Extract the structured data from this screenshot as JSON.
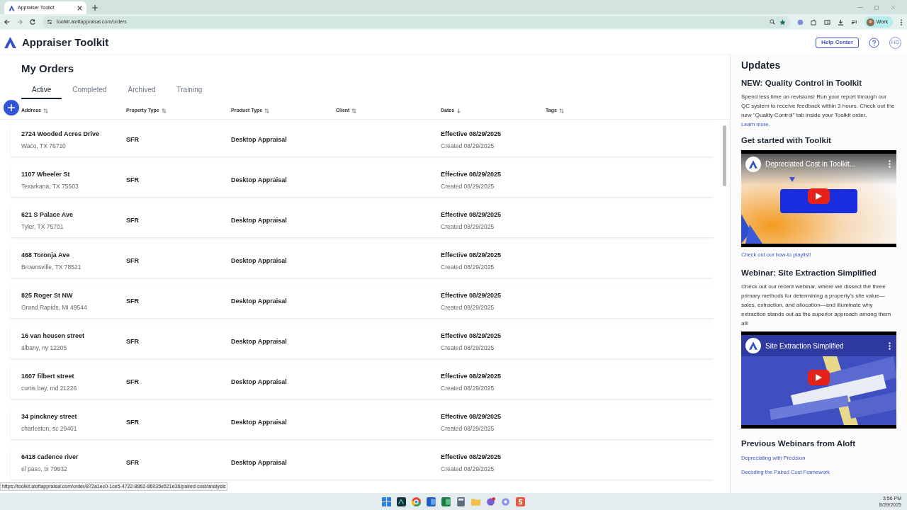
{
  "browser": {
    "tab_title": "Appraiser Toolkit",
    "url": "toolkit.aloftappraisal.com/orders",
    "profile_label": "Work"
  },
  "app": {
    "title": "Appraiser Toolkit",
    "help_button": "Help Center",
    "avatar_initials": "HD"
  },
  "page_title": "My Orders",
  "tabs": [
    {
      "label": "Active",
      "selected": true
    },
    {
      "label": "Completed",
      "selected": false
    },
    {
      "label": "Archived",
      "selected": false
    },
    {
      "label": "Training",
      "selected": false
    }
  ],
  "columns": [
    {
      "label": "Address",
      "sorted": false
    },
    {
      "label": "Property Type",
      "sorted": false
    },
    {
      "label": "Product Type",
      "sorted": false
    },
    {
      "label": "Client",
      "sorted": false
    },
    {
      "label": "Dates",
      "sorted": true
    },
    {
      "label": "Tags",
      "sorted": false
    }
  ],
  "rows": [
    {
      "address": "2724 Wooded Acres Drive",
      "city": "Waco, TX 76710",
      "property_type": "SFR",
      "product_type": "Desktop Appraisal",
      "effective": "Effective 08/29/2025",
      "created": "Created 08/29/2025"
    },
    {
      "address": "1107 Wheeler St",
      "city": "Texarkana, TX 75503",
      "property_type": "SFR",
      "product_type": "Desktop Appraisal",
      "effective": "Effective 08/29/2025",
      "created": "Created 08/29/2025"
    },
    {
      "address": "621 S Palace Ave",
      "city": "Tyler, TX 75701",
      "property_type": "SFR",
      "product_type": "Desktop Appraisal",
      "effective": "Effective 08/29/2025",
      "created": "Created 08/29/2025"
    },
    {
      "address": "468 Toronja Ave",
      "city": "Brownsville, TX 78521",
      "property_type": "SFR",
      "product_type": "Desktop Appraisal",
      "effective": "Effective 08/29/2025",
      "created": "Created 08/29/2025"
    },
    {
      "address": "825 Roger St NW",
      "city": "Grand Rapids, MI 49544",
      "property_type": "SFR",
      "product_type": "Desktop Appraisal",
      "effective": "Effective 08/29/2025",
      "created": "Created 08/29/2025"
    },
    {
      "address": "16 van heusen street",
      "city": "albany, ny 12205",
      "property_type": "SFR",
      "product_type": "Desktop Appraisal",
      "effective": "Effective 08/29/2025",
      "created": "Created 08/29/2025"
    },
    {
      "address": "1607 filbert street",
      "city": "curtis bay, md 21226",
      "property_type": "SFR",
      "product_type": "Desktop Appraisal",
      "effective": "Effective 08/29/2025",
      "created": "Created 08/29/2025"
    },
    {
      "address": "34 pinckney street",
      "city": "charleston, sc 29401",
      "property_type": "SFR",
      "product_type": "Desktop Appraisal",
      "effective": "Effective 08/29/2025",
      "created": "Created 08/29/2025"
    },
    {
      "address": "6418 cadence river",
      "city": "el paso, tx 79932",
      "property_type": "SFR",
      "product_type": "Desktop Appraisal",
      "effective": "Effective 08/29/2025",
      "created": "Created 08/29/2025"
    }
  ],
  "updates": {
    "title": "Updates",
    "qc": {
      "heading": "NEW: Quality Control in Toolkit",
      "body": "Spend less time on revisions! Run your report through our QC system to receive feedback within 3 hours. Check out the new \"Quality Control\" tab inside your Toolkit order.",
      "link": "Learn more."
    },
    "get_started": {
      "heading": "Get started with Toolkit",
      "video_title": "Depreciated Cost in Toolkit...",
      "link": "Check out our how-to playlist!"
    },
    "webinar": {
      "heading": "Webinar: Site Extraction Simplified",
      "body": "Check out our recent webinar, where we dissect the three primary methods for determining a property's site value—sales, extraction, and allocation—and illuminate why extraction stands out as the superior approach among them all!",
      "video_title": "Site Extraction Simplified"
    },
    "previous": {
      "heading": "Previous Webinars from Aloft",
      "links": [
        "Depreciating with Precision",
        "Decoding the Paired Cost Framework"
      ]
    }
  },
  "status_url": "https://toolkit.aloftappraisal.com/order/872a1ec0-1ce5-4722-8862-86035e521e36/paired-cost/analysis",
  "taskbar": {
    "time": "3:56 PM",
    "date": "8/29/2025"
  }
}
